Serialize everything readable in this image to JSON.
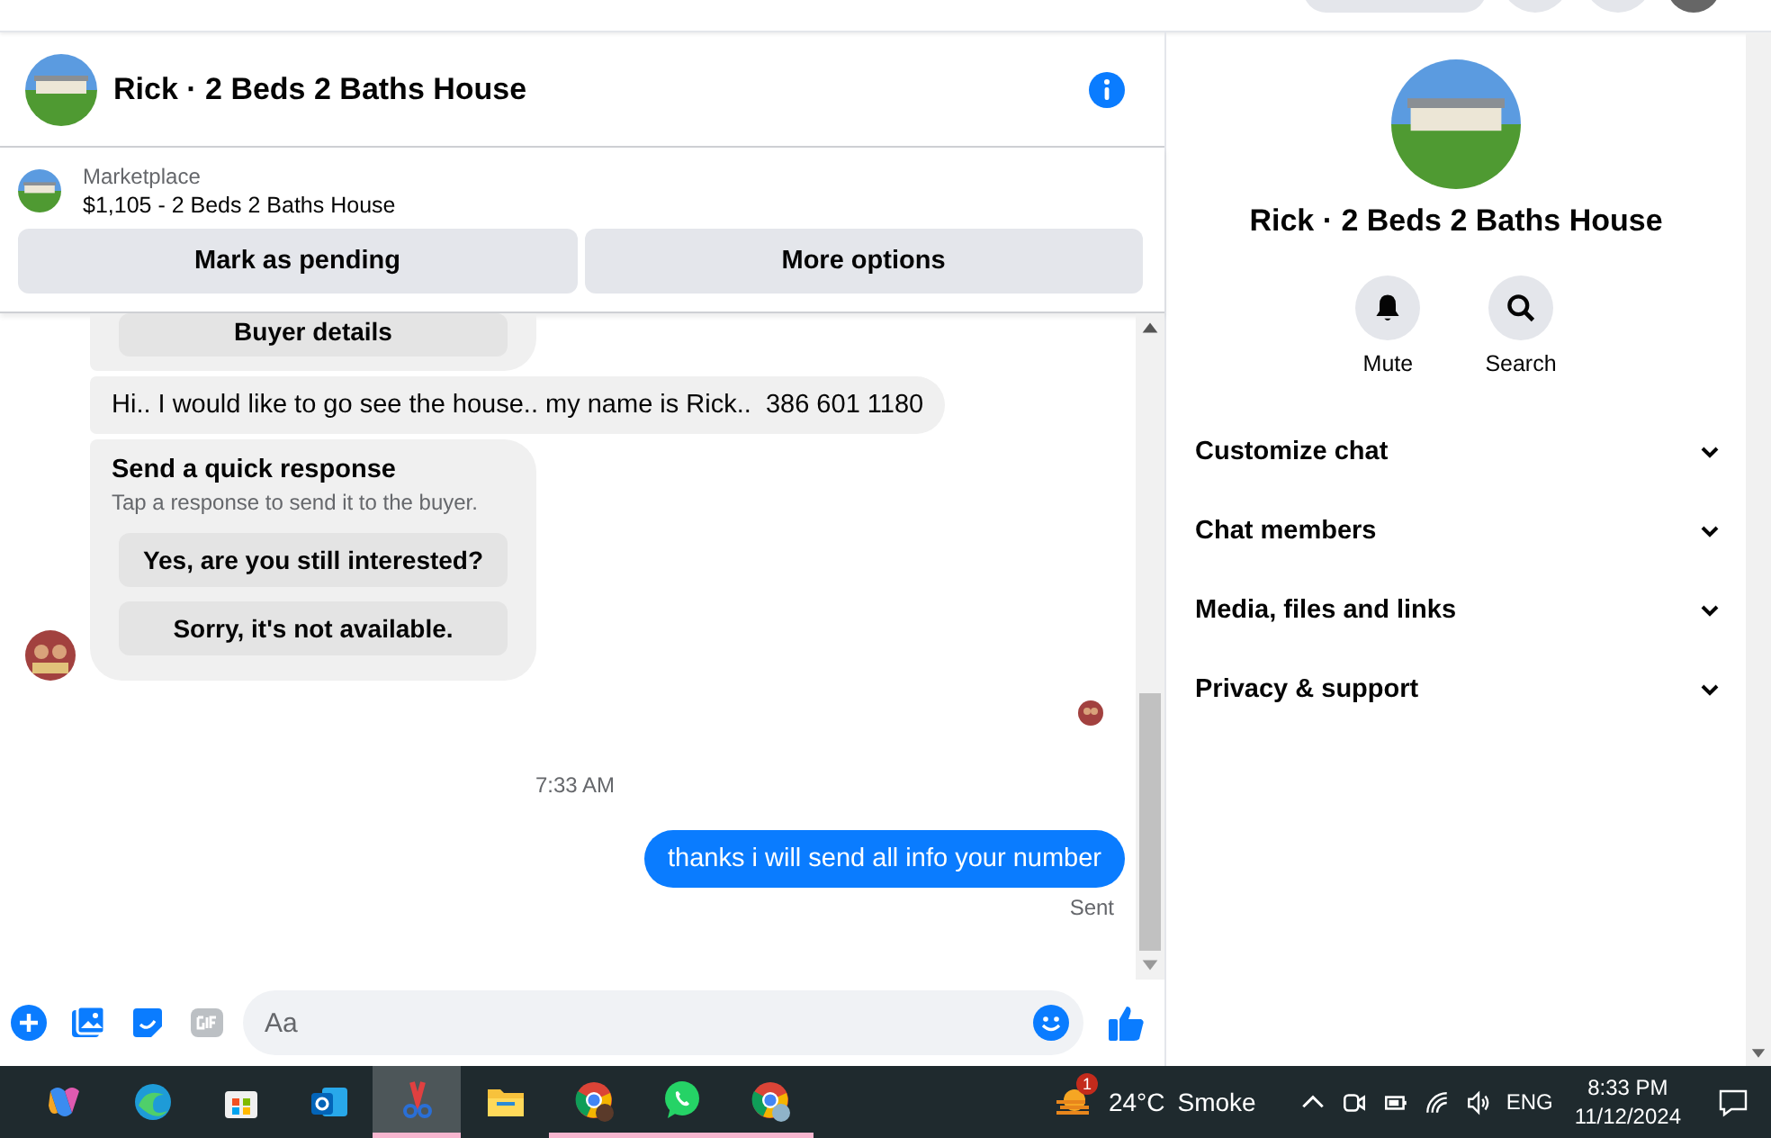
{
  "chat": {
    "title": "Rick · 2 Beds 2 Baths House",
    "listing": {
      "label": "Marketplace",
      "title": "$1,105 - 2 Beds 2 Baths House"
    },
    "actions": [
      "Mark as pending",
      "More options"
    ],
    "messages": [
      {
        "kind": "buyer_details",
        "label": "Buyer details"
      },
      {
        "kind": "incoming",
        "text": "Hi.. I would like to go see the house.. my name is Rick..  386 601 1180"
      },
      {
        "kind": "quick_response",
        "title": "Send a quick response",
        "hint": "Tap a response to send it to the buyer.",
        "options": [
          "Yes, are you still interested?",
          "Sorry, it's not available."
        ]
      },
      {
        "kind": "seen"
      },
      {
        "kind": "timestamp",
        "text": "7:33 AM"
      },
      {
        "kind": "outgoing",
        "text": "thanks i will send all info your number",
        "status": "Sent"
      }
    ],
    "composer": {
      "placeholder": "Aa"
    }
  },
  "details": {
    "title": "Rick · 2 Beds 2 Baths House",
    "actions": [
      {
        "kind": "mute",
        "label": "Mute"
      },
      {
        "kind": "search",
        "label": "Search"
      }
    ],
    "sections": [
      {
        "label": "Customize chat",
        "expanded": false
      },
      {
        "label": "Chat members",
        "expanded": false
      },
      {
        "label": "Media, files and links",
        "expanded": false
      },
      {
        "label": "Privacy & support",
        "expanded": false
      }
    ]
  },
  "taskbar": {
    "apps": [
      {
        "kind": "copilot",
        "running": false,
        "selected": false
      },
      {
        "kind": "edge",
        "running": false,
        "selected": false
      },
      {
        "kind": "store",
        "running": false,
        "selected": false
      },
      {
        "kind": "outlook",
        "running": false,
        "selected": false
      },
      {
        "kind": "snipping",
        "running": true,
        "selected": true
      },
      {
        "kind": "explorer",
        "running": false,
        "selected": false
      },
      {
        "kind": "chrome",
        "running": true,
        "selected": false
      },
      {
        "kind": "whatsapp",
        "running": true,
        "selected": false
      },
      {
        "kind": "chrome2",
        "running": true,
        "selected": false
      }
    ],
    "weather": {
      "badge": "1",
      "temperature": "24°C",
      "condition": "Smoke"
    },
    "language": "ENG",
    "time": "8:33 PM",
    "date": "11/12/2024"
  }
}
